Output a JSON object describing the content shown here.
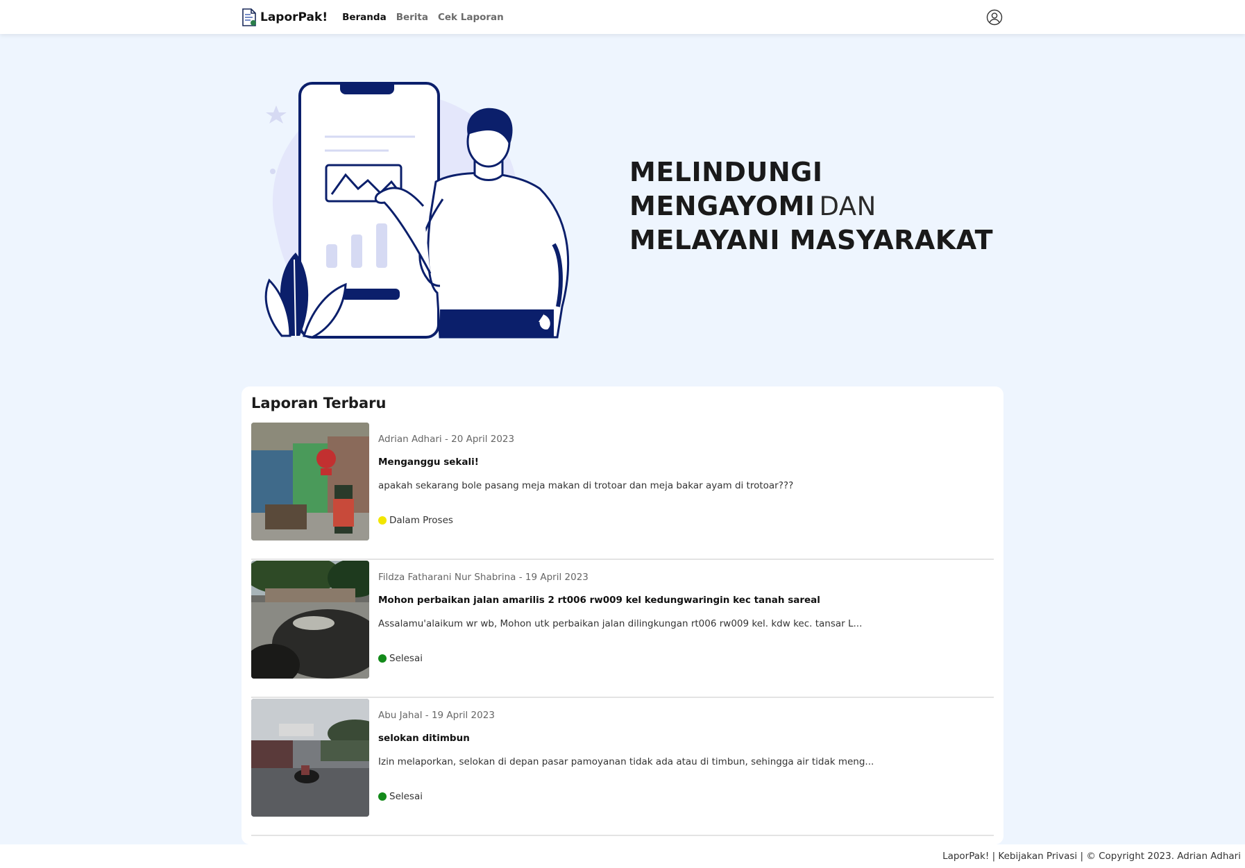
{
  "nav": {
    "brand": "LaporPak!",
    "links": [
      "Beranda",
      "Berita",
      "Cek Laporan"
    ],
    "active_link": "Beranda"
  },
  "hero": {
    "line1": "MELINDUNGI",
    "line2_bold": "MENGAYOMI",
    "line2_light": "DAN",
    "line3": "MELAYANI MASYARAKAT"
  },
  "reports": {
    "title": "Laporan Terbaru",
    "items": [
      {
        "meta": "Adrian Adhari - 20 April 2023",
        "title": "Menganggu sekali!",
        "description": "apakah sekarang bole pasang meja makan di trotoar dan meja bakar ayam di trotoar???",
        "status": "Dalam Proses",
        "status_color": "#f2e600"
      },
      {
        "meta": "Fildza Fatharani Nur Shabrina - 19 April 2023",
        "title": "Mohon perbaikan jalan amarilis 2 rt006 rw009 kel kedungwaringin kec tanah sareal",
        "description": "Assalamu'alaikum wr wb, Mohon utk perbaikan jalan dilingkungan rt006 rw009 kel. kdw kec. tansar L...",
        "status": "Selesai",
        "status_color": "#138a1a"
      },
      {
        "meta": "Abu Jahal - 19 April 2023",
        "title": "selokan ditimbun",
        "description": "Izin melaporkan, selokan di depan pasar pamoyanan tidak ada atau di timbun, sehingga air tidak meng...",
        "status": "Selesai",
        "status_color": "#138a1a"
      }
    ]
  },
  "footer": {
    "text": "LaporPak! | Kebijakan Privasi | © Copyright 2023. Adrian Adhari"
  },
  "colors": {
    "page_bg": "#eef5fe",
    "navy": "#0b1f6b",
    "blob": "#e4e7fb"
  },
  "icons": [
    "document-logo-icon",
    "user-circle-icon"
  ]
}
